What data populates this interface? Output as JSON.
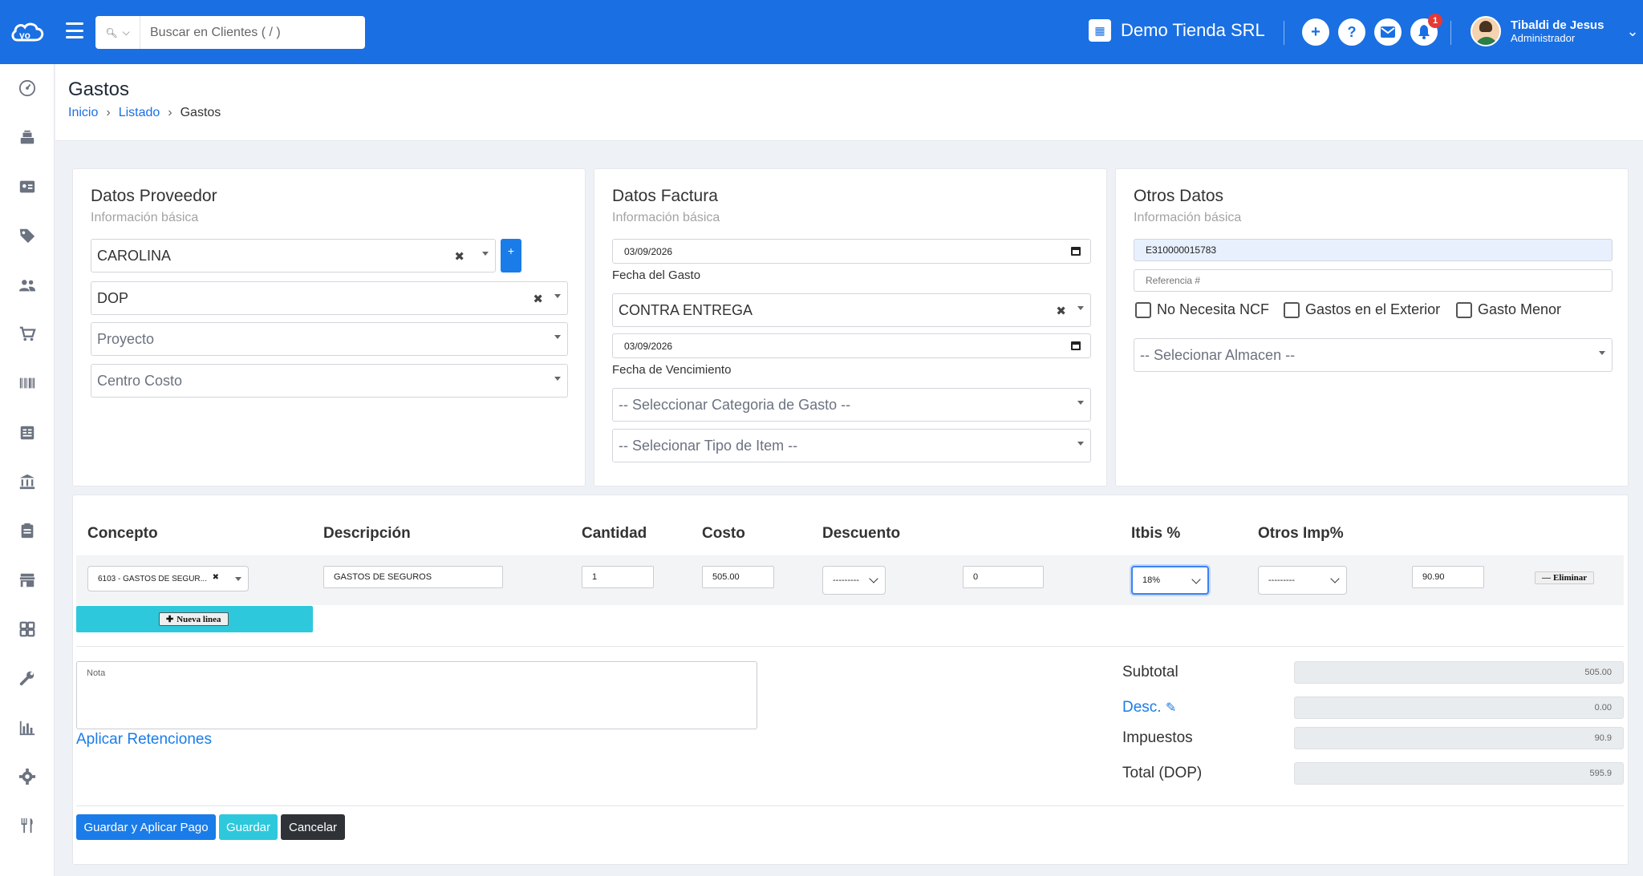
{
  "topbar": {
    "search_placeholder": "Buscar en Clientes ( / )",
    "company_name": "Demo Tienda SRL",
    "notification_count": "1",
    "user_name": "Tibaldi de Jesus",
    "user_role": "Administrador"
  },
  "page": {
    "title": "Gastos",
    "breadcrumb": [
      "Inicio",
      "Listado",
      "Gastos"
    ]
  },
  "proveedor": {
    "title": "Datos Proveedor",
    "subtitle": "Información básica",
    "supplier": "CAROLINA",
    "add_label": "+",
    "currency": "DOP",
    "project_placeholder": "Proyecto",
    "cost_center_placeholder": "Centro Costo"
  },
  "factura": {
    "title": "Datos Factura",
    "subtitle": "Información básica",
    "expense_date": "03/09/2026",
    "expense_date_label": "Fecha del Gasto",
    "payment_term": "CONTRA ENTREGA",
    "due_date": "03/09/2026",
    "due_date_label": "Fecha de Vencimiento",
    "category_placeholder": "-- Seleccionar Categoria de Gasto --",
    "item_type_placeholder": "-- Selecionar Tipo de Item --"
  },
  "otros": {
    "title": "Otros Datos",
    "subtitle": "Información básica",
    "ncf": "E310000015783",
    "reference_placeholder": "Referencia #",
    "check_no_ncf": "No Necesita NCF",
    "check_exterior": "Gastos en el Exterior",
    "check_menor": "Gasto Menor",
    "warehouse_placeholder": "-- Selecionar Almacen --"
  },
  "items": {
    "headers": {
      "concepto": "Concepto",
      "descripcion": "Descripción",
      "cantidad": "Cantidad",
      "costo": "Costo",
      "descuento": "Descuento",
      "itbis": "Itbis %",
      "otros": "Otros Imp%"
    },
    "row": {
      "concepto": "6103 - GASTOS DE SEGUR...",
      "descripcion": "GASTOS DE SEGUROS",
      "cantidad": "1",
      "costo": "505.00",
      "descuento_type": "---------",
      "descuento_value": "0",
      "itbis": "18%",
      "otros": "---------",
      "total": "90.90",
      "delete_label": "Eliminar"
    },
    "new_line_label": "Nueva linea"
  },
  "footer": {
    "nota_placeholder": "Nota",
    "retenciones_link": "Aplicar Retenciones",
    "subtotal_label": "Subtotal",
    "subtotal_value": "505.00",
    "desc_label": "Desc.",
    "desc_value": "0.00",
    "impuestos_label": "Impuestos",
    "impuestos_value": "90.9",
    "total_label": "Total (DOP)",
    "total_value": "595.9"
  },
  "actions": {
    "save_and_pay": "Guardar y Aplicar Pago",
    "save": "Guardar",
    "cancel": "Cancelar"
  },
  "colors": {
    "primary": "#1a6fe3",
    "info": "#2ec8dc",
    "dark": "#2f3338"
  }
}
